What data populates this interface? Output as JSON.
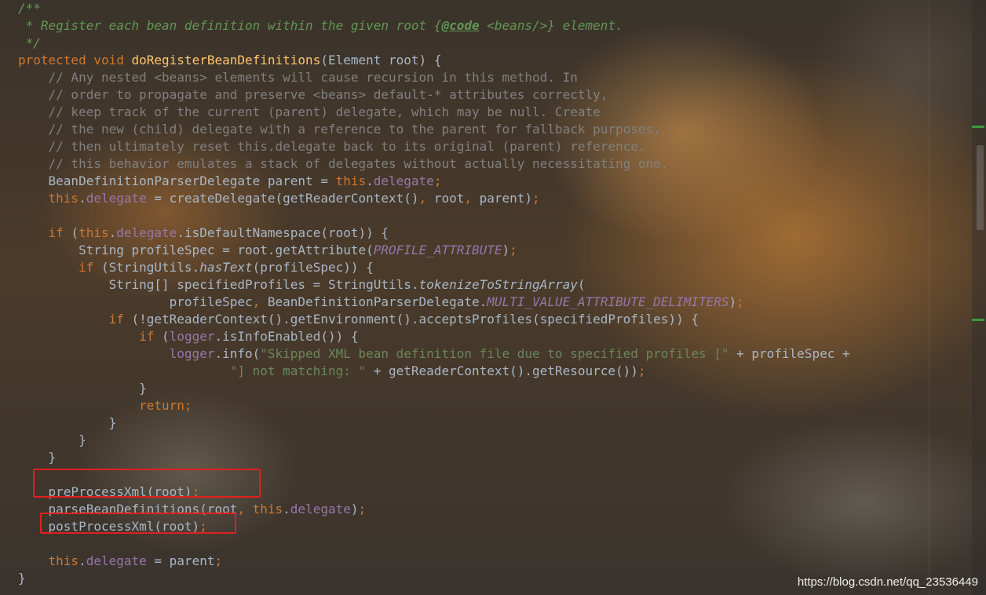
{
  "editor": {
    "code_lines": [
      [
        {
          "c": "doc",
          "t": "/**"
        }
      ],
      [
        {
          "c": "doc",
          "t": " * Register each bean definition within the given root {"
        },
        {
          "c": "doctag",
          "t": "@code"
        },
        {
          "c": "doc",
          "t": " <beans/>} element."
        }
      ],
      [
        {
          "c": "doc",
          "t": " */"
        }
      ],
      [
        {
          "c": "kw",
          "t": "protected void "
        },
        {
          "c": "fn",
          "t": "doRegisterBeanDefinitions"
        },
        {
          "c": "",
          "t": "(Element root) {"
        }
      ],
      [
        {
          "c": "cm",
          "t": "    // Any nested <beans> elements will cause recursion in this method. In"
        }
      ],
      [
        {
          "c": "cm",
          "t": "    // order to propagate and preserve <beans> default-* attributes correctly,"
        }
      ],
      [
        {
          "c": "cm",
          "t": "    // keep track of the current (parent) delegate, which may be null. Create"
        }
      ],
      [
        {
          "c": "cm",
          "t": "    // the new (child) delegate with a reference to the parent for fallback purposes,"
        }
      ],
      [
        {
          "c": "cm",
          "t": "    // then ultimately reset this.delegate back to its original (parent) reference."
        }
      ],
      [
        {
          "c": "cm",
          "t": "    // this behavior emulates a stack of delegates without actually necessitating one."
        }
      ],
      [
        {
          "c": "",
          "t": "    BeanDefinitionParserDelegate parent = "
        },
        {
          "c": "kw",
          "t": "this"
        },
        {
          "c": "",
          "t": "."
        },
        {
          "c": "fld",
          "t": "delegate"
        },
        {
          "c": "kw",
          "t": ";"
        }
      ],
      [
        {
          "c": "",
          "t": "    "
        },
        {
          "c": "kw",
          "t": "this"
        },
        {
          "c": "",
          "t": "."
        },
        {
          "c": "fld",
          "t": "delegate"
        },
        {
          "c": "",
          "t": " = createDelegate(getReaderContext()"
        },
        {
          "c": "kw",
          "t": ", "
        },
        {
          "c": "",
          "t": "root"
        },
        {
          "c": "kw",
          "t": ", "
        },
        {
          "c": "",
          "t": "parent)"
        },
        {
          "c": "kw",
          "t": ";"
        }
      ],
      [],
      [
        {
          "c": "",
          "t": "    "
        },
        {
          "c": "kw",
          "t": "if "
        },
        {
          "c": "",
          "t": "("
        },
        {
          "c": "kw",
          "t": "this"
        },
        {
          "c": "",
          "t": "."
        },
        {
          "c": "fld",
          "t": "delegate"
        },
        {
          "c": "",
          "t": ".isDefaultNamespace(root)) {"
        }
      ],
      [
        {
          "c": "",
          "t": "        String profileSpec = root.getAttribute("
        },
        {
          "c": "fldi",
          "t": "PROFILE_ATTRIBUTE"
        },
        {
          "c": "",
          "t": ")"
        },
        {
          "c": "kw",
          "t": ";"
        }
      ],
      [
        {
          "c": "",
          "t": "        "
        },
        {
          "c": "kw",
          "t": "if "
        },
        {
          "c": "",
          "t": "(StringUtils."
        },
        {
          "c": "it",
          "t": "hasText"
        },
        {
          "c": "",
          "t": "(profileSpec)) {"
        }
      ],
      [
        {
          "c": "",
          "t": "            String[] specifiedProfiles = StringUtils."
        },
        {
          "c": "it",
          "t": "tokenizeToStringArray"
        },
        {
          "c": "",
          "t": "("
        }
      ],
      [
        {
          "c": "",
          "t": "                    profileSpec"
        },
        {
          "c": "kw",
          "t": ", "
        },
        {
          "c": "",
          "t": "BeanDefinitionParserDelegate."
        },
        {
          "c": "fldi",
          "t": "MULTI_VALUE_ATTRIBUTE_DELIMITERS"
        },
        {
          "c": "",
          "t": ")"
        },
        {
          "c": "kw",
          "t": ";"
        }
      ],
      [
        {
          "c": "",
          "t": "            "
        },
        {
          "c": "kw",
          "t": "if "
        },
        {
          "c": "",
          "t": "(!getReaderContext().getEnvironment().acceptsProfiles(specifiedProfiles)) {"
        }
      ],
      [
        {
          "c": "",
          "t": "                "
        },
        {
          "c": "kw",
          "t": "if "
        },
        {
          "c": "",
          "t": "("
        },
        {
          "c": "fld",
          "t": "logger"
        },
        {
          "c": "",
          "t": ".isInfoEnabled()) {"
        }
      ],
      [
        {
          "c": "",
          "t": "                    "
        },
        {
          "c": "fld",
          "t": "logger"
        },
        {
          "c": "",
          "t": ".info("
        },
        {
          "c": "str",
          "t": "\"Skipped XML bean definition file due to specified profiles [\""
        },
        {
          "c": "",
          "t": " + profileSpec +"
        }
      ],
      [
        {
          "c": "str",
          "t": "                            \"] not matching: \""
        },
        {
          "c": "",
          "t": " + getReaderContext().getResource())"
        },
        {
          "c": "kw",
          "t": ";"
        }
      ],
      [
        {
          "c": "",
          "t": "                }"
        }
      ],
      [
        {
          "c": "",
          "t": "                "
        },
        {
          "c": "kw",
          "t": "return;"
        }
      ],
      [
        {
          "c": "",
          "t": "            }"
        }
      ],
      [
        {
          "c": "",
          "t": "        }"
        }
      ],
      [
        {
          "c": "",
          "t": "    }"
        }
      ],
      [],
      [
        {
          "c": "",
          "t": "    preProcessXml(root)"
        },
        {
          "c": "kw",
          "t": ";"
        }
      ],
      [
        {
          "c": "",
          "t": "    parseBeanDefinitions(root"
        },
        {
          "c": "kw",
          "t": ", this"
        },
        {
          "c": "",
          "t": "."
        },
        {
          "c": "fld",
          "t": "delegate"
        },
        {
          "c": "",
          "t": ")"
        },
        {
          "c": "kw",
          "t": ";"
        }
      ],
      [
        {
          "c": "",
          "t": "    postProcessXml(root)"
        },
        {
          "c": "kw",
          "t": ";"
        }
      ],
      [],
      [
        {
          "c": "",
          "t": "    "
        },
        {
          "c": "kw",
          "t": "this"
        },
        {
          "c": "",
          "t": "."
        },
        {
          "c": "fld",
          "t": "delegate"
        },
        {
          "c": "",
          "t": " = parent"
        },
        {
          "c": "kw",
          "t": ";"
        }
      ],
      [
        {
          "c": "",
          "t": "}"
        }
      ]
    ]
  },
  "annotations": {
    "highlight_color": "#e0201f",
    "highlighted": [
      "preProcessXml(root);",
      "postProcessXml(root);"
    ]
  },
  "watermark": "https://blog.csdn.net/qq_23536449",
  "theme": {
    "keyword": "#cc7832",
    "function_decl": "#ffc66d",
    "comment": "#808080",
    "javadoc": "#629755",
    "field": "#9876aa",
    "string": "#6a8759",
    "plain": "#a9b7c6"
  }
}
